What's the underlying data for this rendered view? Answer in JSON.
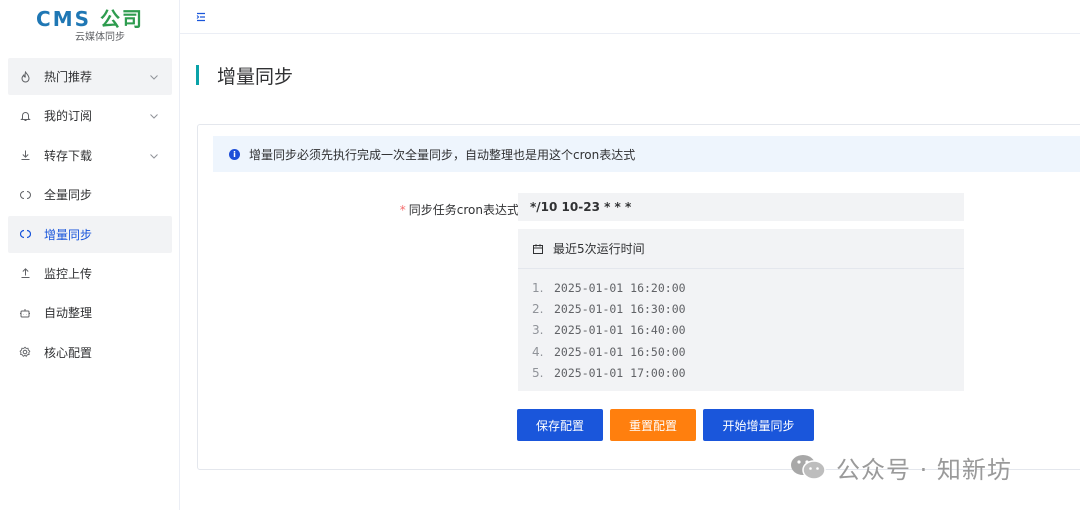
{
  "logo": {
    "title_latin": "CMS",
    "title_cjk": "公司",
    "subtitle": "云媒体同步"
  },
  "sidebar": {
    "items": [
      {
        "label": "热门推荐",
        "icon": "fire-icon",
        "has_submenu": true
      },
      {
        "label": "我的订阅",
        "icon": "bell-icon",
        "has_submenu": true
      },
      {
        "label": "转存下载",
        "icon": "download-icon",
        "has_submenu": true
      },
      {
        "label": "全量同步",
        "icon": "sync-icon",
        "has_submenu": false
      },
      {
        "label": "增量同步",
        "icon": "sync-icon",
        "has_submenu": false,
        "active": true
      },
      {
        "label": "监控上传",
        "icon": "upload-icon",
        "has_submenu": false
      },
      {
        "label": "自动整理",
        "icon": "robot-icon",
        "has_submenu": false
      },
      {
        "label": "核心配置",
        "icon": "gear-icon",
        "has_submenu": false
      }
    ]
  },
  "page": {
    "title": "增量同步"
  },
  "alert": {
    "text": "增量同步必须先执行完成一次全量同步，自动整理也是用这个cron表达式"
  },
  "form": {
    "cron_label": "同步任务cron表达式",
    "required_mark": "*",
    "cron_value": "*/10 10-23 * * *"
  },
  "runs": {
    "title": "最近5次运行时间",
    "items": [
      {
        "index": "1.",
        "time": "2025-01-01 16:20:00"
      },
      {
        "index": "2.",
        "time": "2025-01-01 16:30:00"
      },
      {
        "index": "3.",
        "time": "2025-01-01 16:40:00"
      },
      {
        "index": "4.",
        "time": "2025-01-01 16:50:00"
      },
      {
        "index": "5.",
        "time": "2025-01-01 17:00:00"
      }
    ]
  },
  "buttons": {
    "save": "保存配置",
    "reset": "重置配置",
    "start": "开始增量同步"
  },
  "watermark": {
    "text": "公众号 · 知新坊"
  },
  "colors": {
    "primary": "#1a56db",
    "warning": "#ff7f0e",
    "accent": "#0aa2a8",
    "logo_blue": "#1f77b4",
    "logo_green": "#2e9c4f"
  }
}
